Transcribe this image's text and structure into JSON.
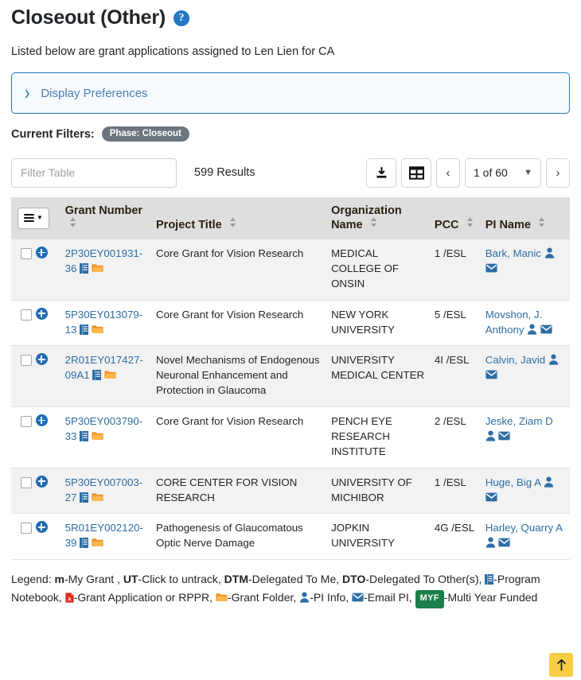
{
  "header": {
    "title": "Closeout (Other)",
    "help_icon": "help-circle-icon",
    "subtitle": "Listed below are grant applications assigned to Len Lien for CA"
  },
  "display_preferences": {
    "label": "Display Preferences",
    "expand_icon": "chevron-right-icon",
    "expanded": false
  },
  "current_filters": {
    "label": "Current Filters:",
    "chips": [
      "Phase: Closeout"
    ]
  },
  "toolbar": {
    "filter_placeholder": "Filter Table",
    "filter_value": "",
    "results_text": "599 Results",
    "download_icon": "download-icon",
    "grid_icon": "table-grid-icon",
    "prev_label": "‹",
    "next_label": "›",
    "page_label": "1 of 60",
    "page_caret": "chevron-down-icon"
  },
  "table": {
    "menu_icon": "column-menu-icon",
    "columns": [
      {
        "label": "Grant Number",
        "sortable": true
      },
      {
        "label": "Project Title",
        "sortable": true
      },
      {
        "label": "Organization Name",
        "sortable": true
      },
      {
        "label": "PCC",
        "sortable": true
      },
      {
        "label": "PI Name",
        "sortable": true
      }
    ],
    "rows": [
      {
        "checked": false,
        "grant_number": "2P30EY001931-36",
        "project_title": "Core Grant for Vision Research",
        "organization_name": "MEDICAL COLLEGE OF ONSIN",
        "pcc": "1 /ESL",
        "pi_name": "Bark, Manic"
      },
      {
        "checked": false,
        "grant_number": "5P30EY013079-13",
        "project_title": "Core Grant for Vision Research",
        "organization_name": "NEW YORK UNIVERSITY",
        "pcc": "5 /ESL",
        "pi_name": "Movshon, J. Anthony"
      },
      {
        "checked": false,
        "grant_number": "2R01EY017427-09A1",
        "project_title": "Novel Mechanisms of Endogenous Neuronal Enhancement and Protection in Glaucoma",
        "organization_name": "UNIVERSITY MEDICAL CENTER",
        "pcc": "4I /ESL",
        "pi_name": "Calvin, Javid"
      },
      {
        "checked": false,
        "grant_number": "5P30EY003790-33",
        "project_title": "Core Grant for Vision Research",
        "organization_name": "PENCH EYE RESEARCH INSTITUTE",
        "pcc": "2 /ESL",
        "pi_name": "Jeske, Ziam D"
      },
      {
        "checked": false,
        "grant_number": "5P30EY007003-27",
        "project_title": "CORE CENTER FOR VISION RESEARCH",
        "organization_name": "UNIVERSITY OF MICHIBOR",
        "pcc": "1 /ESL",
        "pi_name": "Huge, Big A"
      },
      {
        "checked": false,
        "grant_number": "5R01EY002120-39",
        "project_title": "Pathogenesis of Glaucomatous Optic Nerve Damage",
        "organization_name": "JOPKIN UNIVERSITY",
        "pcc": "4G /ESL",
        "pi_name": "Harley, Quarry A"
      }
    ],
    "row_icons": {
      "expand": "expand-plus-icon",
      "notebook": "program-notebook-icon",
      "folder": "grant-folder-icon",
      "pi_info": "pi-info-icon",
      "email": "email-pi-icon"
    }
  },
  "legend": {
    "prefix": "Legend:",
    "entries": [
      {
        "key": "m",
        "text": "-My Grant ,"
      },
      {
        "key": "UT",
        "text": "-Click to untrack,"
      },
      {
        "key": "DTM",
        "text": "-Delegated To Me,"
      },
      {
        "key": "DTO",
        "text": "-Delegated To Other(s),"
      }
    ],
    "icon_entries": [
      {
        "icon": "program-notebook-icon",
        "text": "-Program Notebook,"
      },
      {
        "icon": "pdf-icon",
        "text": "-Grant Application or RPPR,"
      },
      {
        "icon": "grant-folder-icon",
        "text": "-Grant Folder,"
      },
      {
        "icon": "pi-info-icon",
        "text": "-PI Info,"
      },
      {
        "icon": "email-pi-icon",
        "text": "-Email PI,"
      },
      {
        "icon": "myf-badge",
        "text": "-Multi Year Funded"
      }
    ],
    "myf_label": "MYF"
  },
  "scroll_top": {
    "icon": "arrow-up-icon"
  },
  "colors": {
    "link": "#2e6da4",
    "accent_blue": "#2378c3",
    "header_bg": "#dedede",
    "row_alt": "#f2f2f2",
    "chip_gray": "#6c757d",
    "folder_orange": "#f0962a",
    "myf_green": "#1a7f49",
    "pdf_red": "#e02b20",
    "scroll_top_yellow": "#f8cd46"
  }
}
